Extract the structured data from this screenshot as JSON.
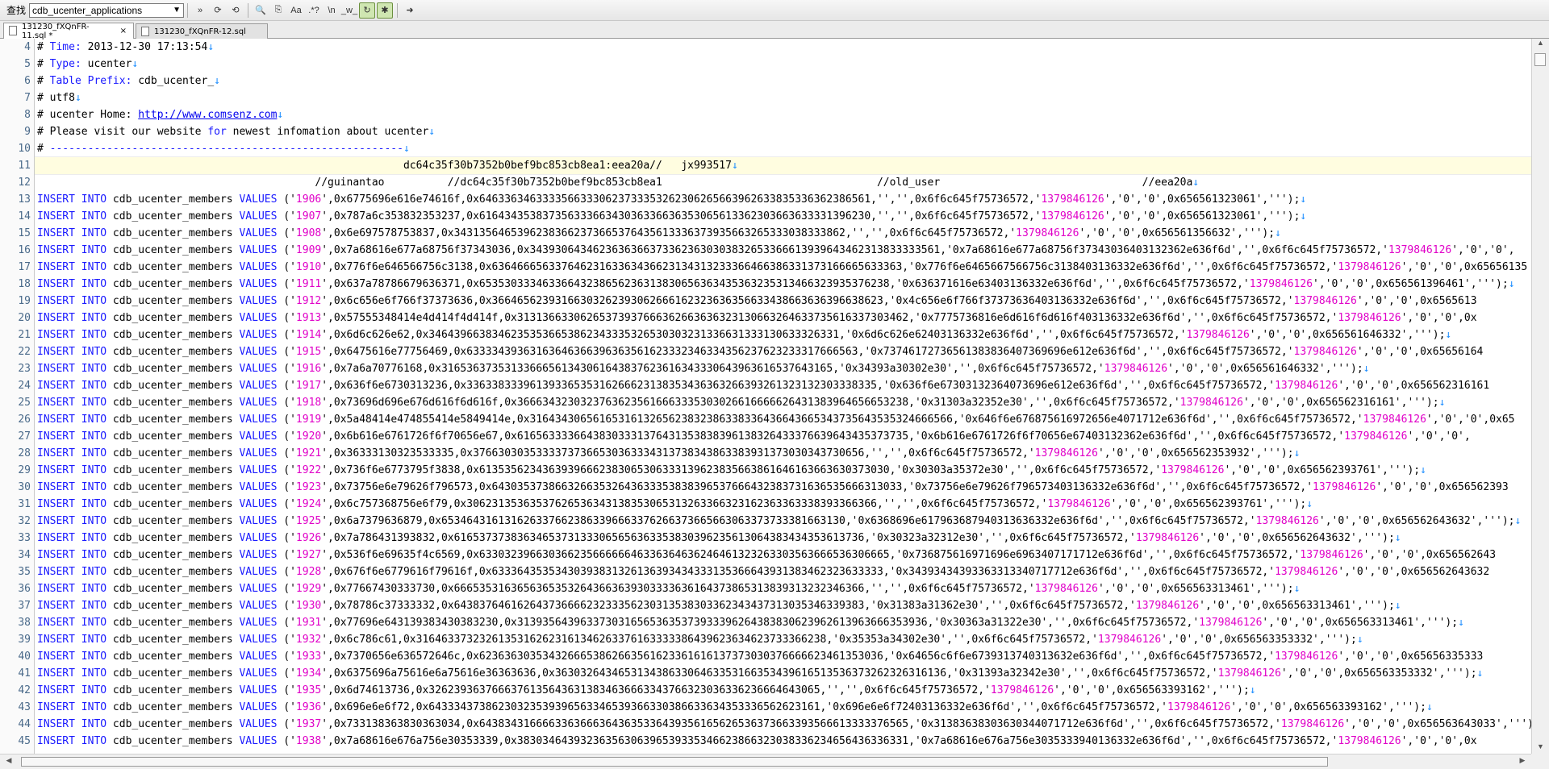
{
  "toolbar": {
    "find_label": "查找",
    "find_value": "cdb_ucenter_applications",
    "buttons": [
      {
        "name": "expand-icon",
        "glyph": "»"
      },
      {
        "name": "find-next-icon",
        "glyph": "⟳"
      },
      {
        "name": "find-prev-icon",
        "glyph": "⟲"
      },
      {
        "name": "search-icon",
        "glyph": "🔍"
      },
      {
        "name": "copy-icon",
        "glyph": "⎘"
      },
      {
        "name": "match-case-icon",
        "glyph": "Aa"
      },
      {
        "name": "regex-icon",
        "glyph": ".*?"
      },
      {
        "name": "newline-icon",
        "glyph": "\\n"
      },
      {
        "name": "whole-word-icon",
        "glyph": "_w_"
      },
      {
        "name": "wrap-icon",
        "glyph": "↻"
      },
      {
        "name": "highlight-all-icon",
        "glyph": "✱"
      },
      {
        "name": "go-icon",
        "glyph": "➜"
      }
    ]
  },
  "tabs": [
    {
      "label": "131230_fXQnFR-11.sql *",
      "active": true,
      "close": "×"
    },
    {
      "label": "131230_fXQnFR-12.sql",
      "active": false,
      "close": ""
    }
  ],
  "colors": {
    "string": "#e000c8",
    "keyword": "#1a1aff",
    "linebreak": "#1a8cff"
  },
  "editor": {
    "line_numbers": [
      "4",
      "5",
      "6",
      "7",
      "8",
      "9",
      "10",
      "11",
      "12",
      "13",
      "14",
      "15",
      "16",
      "17",
      "18",
      "19",
      "20",
      "21",
      "22",
      "23",
      "24",
      "25",
      "26",
      "27",
      "28",
      "29",
      "30",
      "31",
      "32",
      "33",
      "34",
      "35",
      "36",
      "37",
      "38",
      "39",
      "40",
      "41",
      "42",
      "43",
      "44",
      "45"
    ],
    "current_line": 7,
    "header_lines": [
      [
        {
          "t": "# ",
          "c": "cm"
        },
        {
          "t": "Time:",
          "c": "kw-blue"
        },
        {
          "t": " 2013-12-30 17:13:54",
          "c": "cm"
        },
        {
          "t": "↓",
          "c": "ret"
        }
      ],
      [
        {
          "t": "# ",
          "c": "cm"
        },
        {
          "t": "Type:",
          "c": "kw-blue"
        },
        {
          "t": " ucenter",
          "c": "cm"
        },
        {
          "t": "↓",
          "c": "ret"
        }
      ],
      [
        {
          "t": "# ",
          "c": "cm"
        },
        {
          "t": "Table Prefix:",
          "c": "kw-blue"
        },
        {
          "t": " cdb_ucenter_",
          "c": "cm"
        },
        {
          "t": "↓",
          "c": "ret"
        }
      ],
      [
        {
          "t": "# utf8",
          "c": "cm"
        },
        {
          "t": "↓",
          "c": "ret"
        }
      ],
      [
        {
          "t": "# ucenter Home: ",
          "c": "cm"
        },
        {
          "t": "http://www.comsenz.com",
          "c": "url"
        },
        {
          "t": "↓",
          "c": "ret"
        }
      ],
      [
        {
          "t": "# Please visit our website ",
          "c": "cm"
        },
        {
          "t": "for",
          "c": "kw-blue"
        },
        {
          "t": " newest infomation about ucenter",
          "c": "cm"
        },
        {
          "t": "↓",
          "c": "ret"
        }
      ],
      [
        {
          "t": "# ",
          "c": "cm"
        },
        {
          "t": "--------------------------------------------------------",
          "c": "kw-blue"
        },
        {
          "t": "↓",
          "c": "ret"
        }
      ],
      [
        {
          "t": "                                                          dc64c35f30b7352b0bef9bc853cb8ea1:eea20a//   jx993517",
          "c": "cm"
        },
        {
          "t": "↓",
          "c": "ret"
        }
      ],
      [
        {
          "t": "                                            //guinantao          //dc64c35f30b7352b0bef9bc853cb8ea1                                  //old_user                                //eea20a",
          "c": "cm"
        },
        {
          "t": "↓",
          "c": "ret"
        }
      ]
    ],
    "insert_prefix": "INSERT INTO",
    "table": " cdb_ucenter_members ",
    "values_kw": "VALUES",
    "flag": "1379846126",
    "rows": [
      {
        "id": "1906",
        "a": "0x6775696e616e74616f",
        "b": "0x64633634633335663330623733353262306265663962633835336362386561",
        "c": "",
        "d": "0x656561323061",
        "tail": "',''');↓"
      },
      {
        "id": "1907",
        "a": "0x787a6c353832353237",
        "b": "0x61643435383735633366343036336636353065613362303663633331396230",
        "c": "",
        "d": "0x656561323061",
        "tail": "',''');↓"
      },
      {
        "id": "1908",
        "a": "0x6e697578753837",
        "b": "0x34313564653962383662373665376435613336373935663265333038333862",
        "c": "",
        "d": "0x656561356632",
        "tail": "',''');↓"
      },
      {
        "id": "1909",
        "a": "0x7a68616e677a68756f37343036",
        "b": "0x34393064346236363663733623630303832653366613939643462313833333561",
        "c": "0x7a68616e677a68756f37343036403132362e636f6d",
        "d": "",
        "tail": ""
      },
      {
        "id": "1910",
        "a": "0x776f6e646566756c3138",
        "b": "0x63646665633764623163363436623134313233366466386331373166665633363",
        "c": "0x776f6e6465667566756c3138403136332e636f6d",
        "d": "0x65656135",
        "tail": ""
      },
      {
        "id": "1911",
        "a": "0x637a78786679636371",
        "b": "0x65353033346336643238656236313830656363435363235313466323935376238",
        "c": "0x636371616e63403136332e636f6d",
        "d": "0x656561396461",
        "tail": "',''');↓"
      },
      {
        "id": "1912",
        "a": "0x6c656e6f766f37373636",
        "b": "0x36646562393166303262393062666162323636356633438663636396638623",
        "c": "0x4c656e6f766f37373636403136332e636f6d",
        "d": "0x6565613",
        "tail": ""
      },
      {
        "id": "1913",
        "a": "0x57555348414e4d414f4d414f",
        "b": "0x31313663306265373937666362663636323130663264633735616337303462",
        "c": "0x7775736816e6d616f6d616f403136332e636f6d",
        "d": "0x",
        "tail": ""
      },
      {
        "id": "1914",
        "a": "0x6d6c626e62",
        "b": "0x34643966383462353536653862343335326530303231336631333130633326331",
        "c": "0x6d6c626e62403136332e636f6d",
        "d": "0x656561646332",
        "tail": "',''');↓"
      },
      {
        "id": "1915",
        "a": "0x6475616e77756469",
        "b": "0x63333439363163646366396363561623332346334356237623233317666563",
        "c": "0x73746172736561383836407369696e612e636f6d",
        "d": "0x65656164",
        "tail": ""
      },
      {
        "id": "1916",
        "a": "0x7a6a70776168",
        "b": "0x31653637353133666561343061643837623616343330643963616537643165",
        "c": "0x34393a30302e30",
        "d": "0x656561646332",
        "tail": "',''');↓"
      },
      {
        "id": "1917",
        "a": "0x636f6e6730313236",
        "b": "0x33633833396139336535316266623138353436363266393261323132303338335",
        "c": "0x636f6e67303132364073696e612e636f6d",
        "d": "0x656562316161",
        "tail": ""
      },
      {
        "id": "1918",
        "a": "0x73696d696e676d616f6d616f",
        "b": "0x36663432303237636235616663335303026616666626431383964656653238",
        "c": "0x31303a32352e30",
        "d": "0x656562316161",
        "tail": "',''');↓"
      },
      {
        "id": "1919",
        "a": "0x5a48414e474855414e5849414e",
        "b": "0x3164343065616531613265623832386338336436643665343735643535324666566",
        "c": "0x646f6e676875616972656e4071712e636f6d",
        "d": "0x65",
        "tail": ""
      },
      {
        "id": "1920",
        "a": "0x6b616e6761726f6f70656e67",
        "b": "0x61656333366438303331376431353838396138326433376639643435373735",
        "c": "0x6b616e6761726f6f70656e67403132362e636f6d",
        "d": "",
        "tail": ""
      },
      {
        "id": "1921",
        "a": "0x36333130323533335",
        "b": "0x37663030353333737366530363334313738343863383931373030343730656",
        "c": "",
        "d": "0x656562353932",
        "tail": "',''');↓"
      },
      {
        "id": "1922",
        "a": "0x736f6e6773795f3838",
        "b": "0x61353562343639396662383065306333139623835663861646163663630373030",
        "c": "0x30303a35372e30",
        "d": "0x656562393761",
        "tail": "',''');↓"
      },
      {
        "id": "1923",
        "a": "0x73756e6e79626f796573",
        "b": "0x64303537386632663532643633353838396537666432383731636535666313033",
        "c": "0x73756e6e79626f796573403136332e636f6d",
        "d": "0x656562393",
        "tail": ""
      },
      {
        "id": "1924",
        "a": "0x6c757368756e6f79",
        "b": "0x30623135363537626536343138353065313263366323162363363338393366366",
        "c": "",
        "d": "0x656562393761",
        "tail": "',''');↓"
      },
      {
        "id": "1925",
        "a": "0x6a7379636879",
        "b": "0x6534643161316263376623863396663376266373665663063373733381663130",
        "c": "0x6368696e617963687940313636332e636f6d",
        "d": "0x656562643632",
        "tail": "',''');↓"
      },
      {
        "id": "1926",
        "a": "0x7a786431393832",
        "b": "0x61653737383634653731333065656363353830396235613064383434353613736",
        "c": "0x30323a32312e30",
        "d": "0x656562643632",
        "tail": "',''');↓"
      },
      {
        "id": "1927",
        "a": "0x536f6e69635f4c6569",
        "b": "0x63303239663036623566666646336364636246461323263303563666536306665",
        "c": "0x736875616971696e6963407171712e636f6d",
        "d": "0x656562643",
        "tail": ""
      },
      {
        "id": "1928",
        "a": "0x676f6e6779616f79616f",
        "b": "0x63336435353430393831326136393434333135366643931383462323633333",
        "c": "0x34393434393363313340717712e636f6d",
        "d": "0x656562643632",
        "tail": ""
      },
      {
        "id": "1929",
        "a": "0x77667430333730",
        "b": "0x66653531636563653532643663639303333636164373865313839313232346366",
        "c": "",
        "d": "0x656563313461",
        "tail": "',''');↓"
      },
      {
        "id": "1930",
        "a": "0x78786c37333332",
        "b": "0x64383764616264373666623233356230313538303362343437313035346339383",
        "c": "0x31383a31362e30",
        "d": "0x656563313461",
        "tail": "',''');↓"
      },
      {
        "id": "1931",
        "a": "0x77696e643139383430383230",
        "b": "0x31393564396337303165653635373933396264383830623962613963666353936",
        "c": "0x30363a31322e30",
        "d": "0x656563313461",
        "tail": "',''');↓"
      },
      {
        "id": "1932",
        "a": "0x6c786c61",
        "b": "0x31646337323261353162623161346263376163333386439623634623733366238",
        "c": "0x35353a34302e30",
        "d": "0x656563353332",
        "tail": "',''');↓"
      },
      {
        "id": "1933",
        "a": "0x7370656e636572646c",
        "b": "0x6236363035343266653862663561623361616137373030376666623461353036",
        "c": "0x64656c6f6e6739313740313632e636f6d",
        "d": "0x65656335333",
        "tail": ""
      },
      {
        "id": "1934",
        "a": "0x6375696a75616e6a75616e36363636",
        "b": "0x36303264346531343863306463353166353439616513536373262326316136",
        "c": "0x31393a32342e30",
        "d": "0x656563353332",
        "tail": "',''');↓"
      },
      {
        "id": "1935",
        "a": "0x6d74613736",
        "b": "0x32623936376663761356436313834636663343766323036336236664643065",
        "c": "",
        "d": "0x656563393162",
        "tail": "',''');↓"
      },
      {
        "id": "1936",
        "a": "0x696e6e6f72",
        "b": "0x64333437386230323539396563346539366330386633634353336562623161",
        "c": "0x696e6e6f72403136332e636f6d",
        "d": "0x656563393162",
        "tail": "',''');↓"
      },
      {
        "id": "1937",
        "a": "0x733138363830363034",
        "b": "0x64383431666633636663643635336439356165626536373663393566613333376565",
        "c": "0x31383638303630344071712e636f6d",
        "d": "0x656563643033",
        "tail": "',''');↓"
      },
      {
        "id": "1938",
        "a": "0x7a68616e676a756e30353339",
        "b": "0x38303464393236356306396539335346623866323038336234656436336331",
        "c": "0x7a68616e676a756e3035333940136332e636f6d",
        "d": "0x",
        "tail": ""
      }
    ]
  }
}
